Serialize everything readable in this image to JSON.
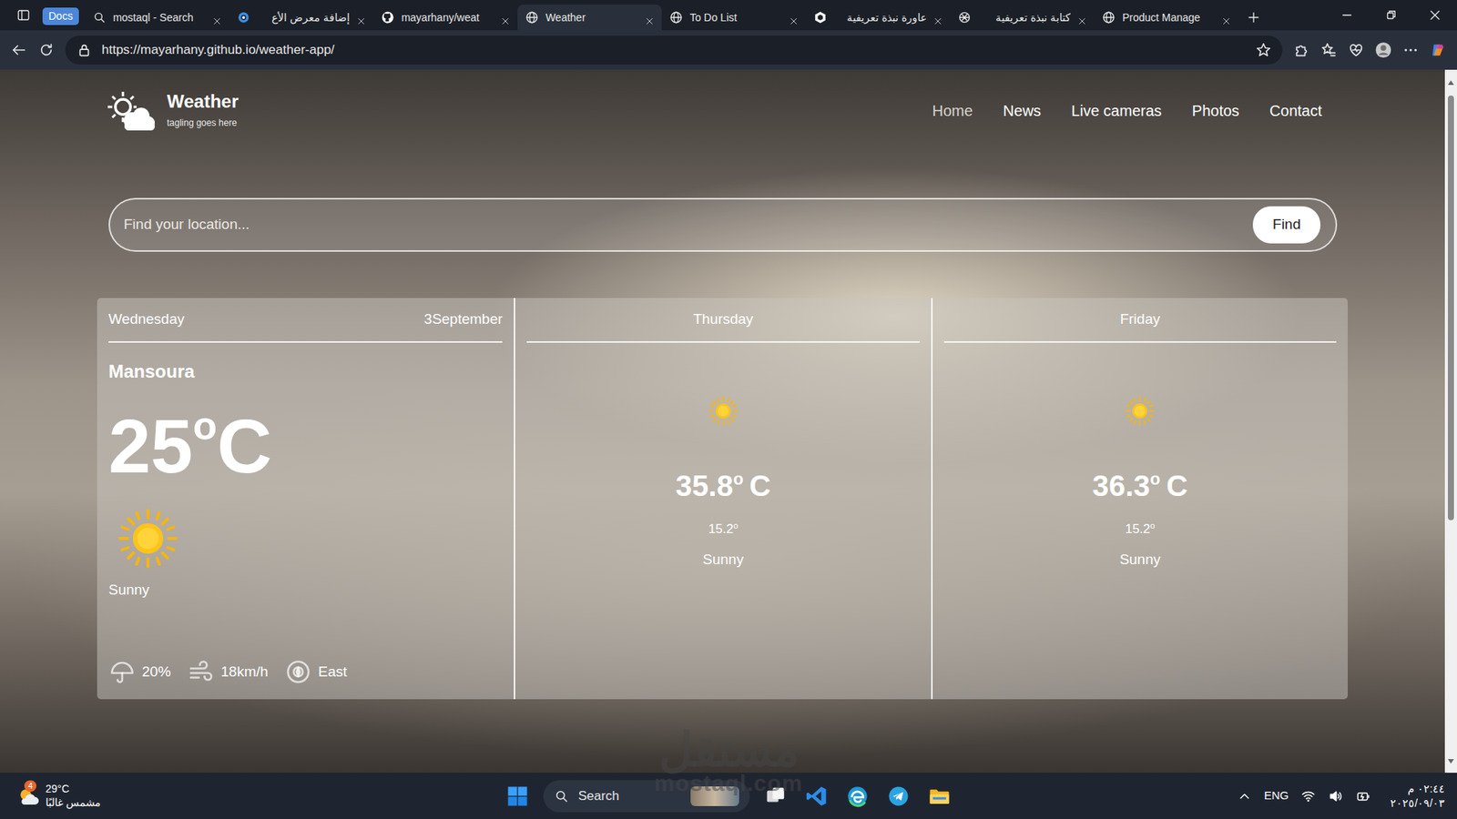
{
  "browser": {
    "tab_group": "Docs",
    "tabs": [
      {
        "label": "mostaql - Search",
        "selected": false,
        "kind": "search"
      },
      {
        "label": "إضافة معرض الأع",
        "selected": false,
        "kind": "ring"
      },
      {
        "label": "mayarhany/weat",
        "selected": false,
        "kind": "github"
      },
      {
        "label": "Weather",
        "selected": true,
        "kind": "globe"
      },
      {
        "label": "To Do List",
        "selected": false,
        "kind": "globe"
      },
      {
        "label": "عاورة نبذة تعريفية",
        "selected": false,
        "kind": "hex"
      },
      {
        "label": "كتابة نبذة تعريفية",
        "selected": false,
        "kind": "knot"
      },
      {
        "label": "Product Manage",
        "selected": false,
        "kind": "globe"
      }
    ],
    "url": "https://mayarhany.github.io/weather-app/"
  },
  "page": {
    "brand": {
      "name": "Weather",
      "tagline": "tagling goes here"
    },
    "nav": [
      {
        "label": "Home",
        "selected": true
      },
      {
        "label": "News",
        "selected": false
      },
      {
        "label": "Live cameras",
        "selected": false
      },
      {
        "label": "Photos",
        "selected": false
      },
      {
        "label": "Contact",
        "selected": false
      }
    ],
    "search": {
      "placeholder": "Find your location...",
      "button": "Find"
    },
    "today": {
      "day": "Wednesday",
      "date": "3September",
      "city": "Mansoura",
      "temp": "25",
      "deg": "o",
      "unit": "C",
      "condition": "Sunny",
      "stats": [
        {
          "value": "20%",
          "kind": "umbrella"
        },
        {
          "value": "18km/h",
          "kind": "wind"
        },
        {
          "value": "East",
          "kind": "compass"
        }
      ]
    },
    "forecast": [
      {
        "day": "Thursday",
        "max": "35.8",
        "deg": "o",
        "unit": "C",
        "min": "15.2",
        "min_deg": "o",
        "condition": "Sunny"
      },
      {
        "day": "Friday",
        "max": "36.3",
        "deg": "o",
        "unit": "C",
        "min": "15.2",
        "min_deg": "o",
        "condition": "Sunny"
      }
    ]
  },
  "watermark": {
    "arabic": "مستقل",
    "latin": "mostaql.com"
  },
  "taskbar": {
    "weather": {
      "temp": "29°C",
      "condition": "مشمس غالبًا",
      "badge": "4"
    },
    "search": "Search",
    "language": "ENG",
    "time": "٠٢:٤٤ م",
    "date": "٢٠٢٥/٠٩/٠٣"
  }
}
